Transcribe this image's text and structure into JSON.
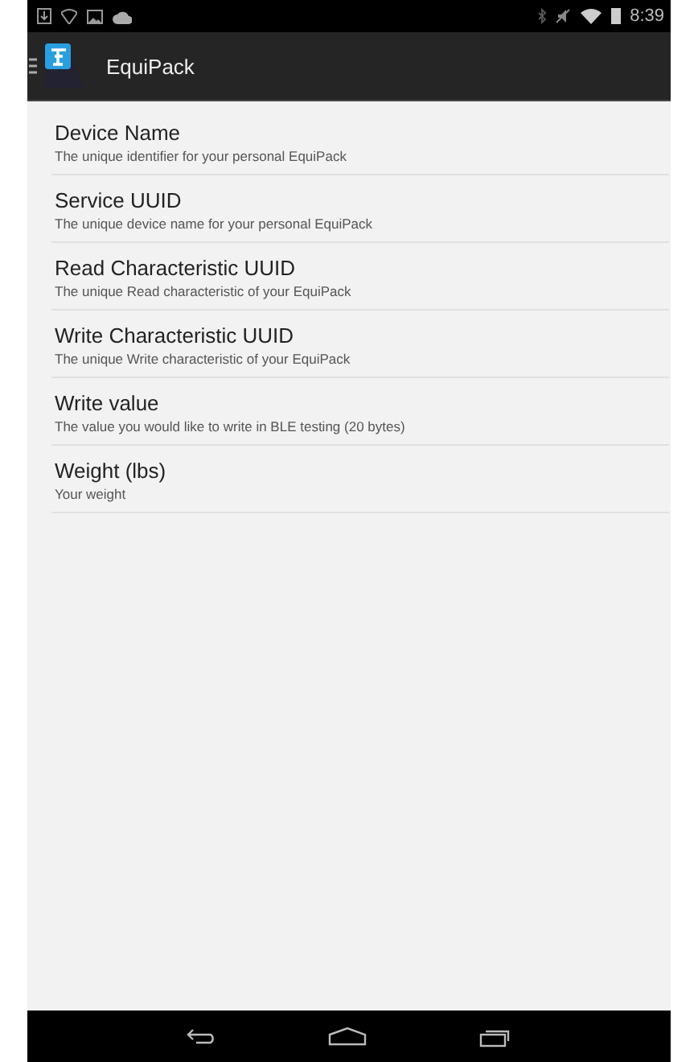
{
  "status_bar": {
    "time": "8:39"
  },
  "action_bar": {
    "title": "EquiPack"
  },
  "settings": [
    {
      "title": "Device Name",
      "summary": "The unique identifier for your personal EquiPack"
    },
    {
      "title": "Service UUID",
      "summary": "The unique device name for your personal EquiPack"
    },
    {
      "title": "Read Characteristic UUID",
      "summary": "The unique Read characteristic of your EquiPack"
    },
    {
      "title": "Write Characteristic UUID",
      "summary": "The unique Write characteristic of your EquiPack"
    },
    {
      "title": "Write value",
      "summary": "The value you would like to write in BLE testing (20 bytes)"
    },
    {
      "title": "Weight (lbs)",
      "summary": "Your weight"
    }
  ]
}
